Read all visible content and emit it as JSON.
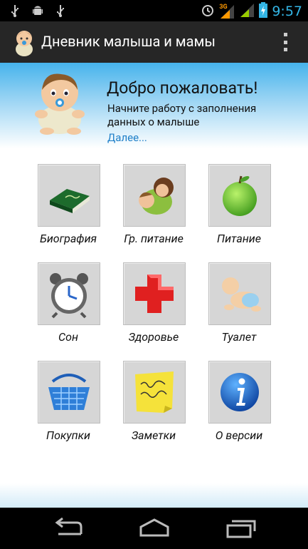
{
  "status_bar": {
    "time": "9:57",
    "network_label": "3G",
    "icons": [
      "usb-icon",
      "android-debug-icon",
      "usb-icon",
      "alarm-icon",
      "signal-3g-icon",
      "signal-icon",
      "battery-charging-icon"
    ]
  },
  "action_bar": {
    "title": "Дневник малыша и мамы",
    "logo_icon": "baby-icon",
    "menu_icon": "overflow-menu-icon"
  },
  "welcome": {
    "title": "Добро пожаловать!",
    "subtitle": "Начните работу с заполнения данных о малыше",
    "link": "Далее..."
  },
  "tiles": [
    {
      "label": "Биография",
      "icon": "book-icon"
    },
    {
      "label": "Гр. питание",
      "icon": "breastfeeding-icon"
    },
    {
      "label": "Питание",
      "icon": "apple-icon"
    },
    {
      "label": "Сон",
      "icon": "alarm-clock-icon"
    },
    {
      "label": "Здоровье",
      "icon": "red-cross-icon"
    },
    {
      "label": "Туалет",
      "icon": "baby-crawling-icon"
    },
    {
      "label": "Покупки",
      "icon": "shopping-basket-icon"
    },
    {
      "label": "Заметки",
      "icon": "sticky-note-icon"
    },
    {
      "label": "О версии",
      "icon": "info-icon"
    }
  ],
  "nav_bar": {
    "buttons": [
      "back-icon",
      "home-icon",
      "recent-apps-icon"
    ]
  },
  "colors": {
    "accent_blue": "#33b5e5",
    "link_blue": "#1e7fc8",
    "action_bar_bg": "#262626",
    "tile_bg": "#d6d6d6"
  }
}
